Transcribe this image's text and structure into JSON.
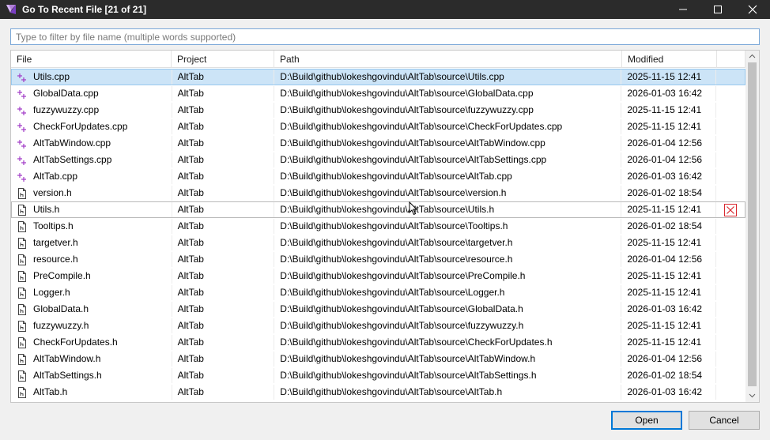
{
  "window": {
    "title": "Go To Recent File [21 of 21]",
    "controls": [
      "minimize",
      "maximize",
      "close"
    ]
  },
  "filter": {
    "placeholder": "Type to filter by file name (multiple words supported)",
    "value": ""
  },
  "columns": {
    "file": "File",
    "project": "Project",
    "path": "Path",
    "modified": "Modified"
  },
  "rows": [
    {
      "icon": "cpp-file-icon",
      "file": "Utils.cpp",
      "project": "AltTab",
      "path": "D:\\Build\\github\\lokeshgovindu\\AltTab\\source\\Utils.cpp",
      "modified": "2025-11-15 12:41"
    },
    {
      "icon": "cpp-file-icon",
      "file": "GlobalData.cpp",
      "project": "AltTab",
      "path": "D:\\Build\\github\\lokeshgovindu\\AltTab\\source\\GlobalData.cpp",
      "modified": "2026-01-03 16:42"
    },
    {
      "icon": "cpp-file-icon",
      "file": "fuzzywuzzy.cpp",
      "project": "AltTab",
      "path": "D:\\Build\\github\\lokeshgovindu\\AltTab\\source\\fuzzywuzzy.cpp",
      "modified": "2025-11-15 12:41"
    },
    {
      "icon": "cpp-file-icon",
      "file": "CheckForUpdates.cpp",
      "project": "AltTab",
      "path": "D:\\Build\\github\\lokeshgovindu\\AltTab\\source\\CheckForUpdates.cpp",
      "modified": "2025-11-15 12:41"
    },
    {
      "icon": "cpp-file-icon",
      "file": "AltTabWindow.cpp",
      "project": "AltTab",
      "path": "D:\\Build\\github\\lokeshgovindu\\AltTab\\source\\AltTabWindow.cpp",
      "modified": "2026-01-04 12:56"
    },
    {
      "icon": "cpp-file-icon",
      "file": "AltTabSettings.cpp",
      "project": "AltTab",
      "path": "D:\\Build\\github\\lokeshgovindu\\AltTab\\source\\AltTabSettings.cpp",
      "modified": "2026-01-04 12:56"
    },
    {
      "icon": "cpp-file-icon",
      "file": "AltTab.cpp",
      "project": "AltTab",
      "path": "D:\\Build\\github\\lokeshgovindu\\AltTab\\source\\AltTab.cpp",
      "modified": "2026-01-03 16:42"
    },
    {
      "icon": "header-file-icon",
      "file": "version.h",
      "project": "AltTab",
      "path": "D:\\Build\\github\\lokeshgovindu\\AltTab\\source\\version.h",
      "modified": "2026-01-02 18:54"
    },
    {
      "icon": "header-file-icon",
      "file": "Utils.h",
      "project": "AltTab",
      "path": "D:\\Build\\github\\lokeshgovindu\\AltTab\\source\\Utils.h",
      "modified": "2025-11-15 12:41"
    },
    {
      "icon": "header-file-icon",
      "file": "Tooltips.h",
      "project": "AltTab",
      "path": "D:\\Build\\github\\lokeshgovindu\\AltTab\\source\\Tooltips.h",
      "modified": "2026-01-02 18:54"
    },
    {
      "icon": "header-file-icon",
      "file": "targetver.h",
      "project": "AltTab",
      "path": "D:\\Build\\github\\lokeshgovindu\\AltTab\\source\\targetver.h",
      "modified": "2025-11-15 12:41"
    },
    {
      "icon": "header-file-icon",
      "file": "resource.h",
      "project": "AltTab",
      "path": "D:\\Build\\github\\lokeshgovindu\\AltTab\\source\\resource.h",
      "modified": "2026-01-04 12:56"
    },
    {
      "icon": "header-file-icon",
      "file": "PreCompile.h",
      "project": "AltTab",
      "path": "D:\\Build\\github\\lokeshgovindu\\AltTab\\source\\PreCompile.h",
      "modified": "2025-11-15 12:41"
    },
    {
      "icon": "header-file-icon",
      "file": "Logger.h",
      "project": "AltTab",
      "path": "D:\\Build\\github\\lokeshgovindu\\AltTab\\source\\Logger.h",
      "modified": "2025-11-15 12:41"
    },
    {
      "icon": "header-file-icon",
      "file": "GlobalData.h",
      "project": "AltTab",
      "path": "D:\\Build\\github\\lokeshgovindu\\AltTab\\source\\GlobalData.h",
      "modified": "2026-01-03 16:42"
    },
    {
      "icon": "header-file-icon",
      "file": "fuzzywuzzy.h",
      "project": "AltTab",
      "path": "D:\\Build\\github\\lokeshgovindu\\AltTab\\source\\fuzzywuzzy.h",
      "modified": "2025-11-15 12:41"
    },
    {
      "icon": "header-file-icon",
      "file": "CheckForUpdates.h",
      "project": "AltTab",
      "path": "D:\\Build\\github\\lokeshgovindu\\AltTab\\source\\CheckForUpdates.h",
      "modified": "2025-11-15 12:41"
    },
    {
      "icon": "header-file-icon",
      "file": "AltTabWindow.h",
      "project": "AltTab",
      "path": "D:\\Build\\github\\lokeshgovindu\\AltTab\\source\\AltTabWindow.h",
      "modified": "2026-01-04 12:56"
    },
    {
      "icon": "header-file-icon",
      "file": "AltTabSettings.h",
      "project": "AltTab",
      "path": "D:\\Build\\github\\lokeshgovindu\\AltTab\\source\\AltTabSettings.h",
      "modified": "2026-01-02 18:54"
    },
    {
      "icon": "header-file-icon",
      "file": "AltTab.h",
      "project": "AltTab",
      "path": "D:\\Build\\github\\lokeshgovindu\\AltTab\\source\\AltTab.h",
      "modified": "2026-01-03 16:42"
    }
  ],
  "selected_row": 0,
  "hovered_row": 8,
  "remove_icon_row": 8,
  "buttons": {
    "open": "Open",
    "cancel": "Cancel"
  },
  "colors": {
    "accent": "#0078d7",
    "selection": "#cce4f7",
    "cpp_icon": "#a23cc7",
    "remove_icon": "#d9282f",
    "titlebar": "#2b2b2b"
  }
}
